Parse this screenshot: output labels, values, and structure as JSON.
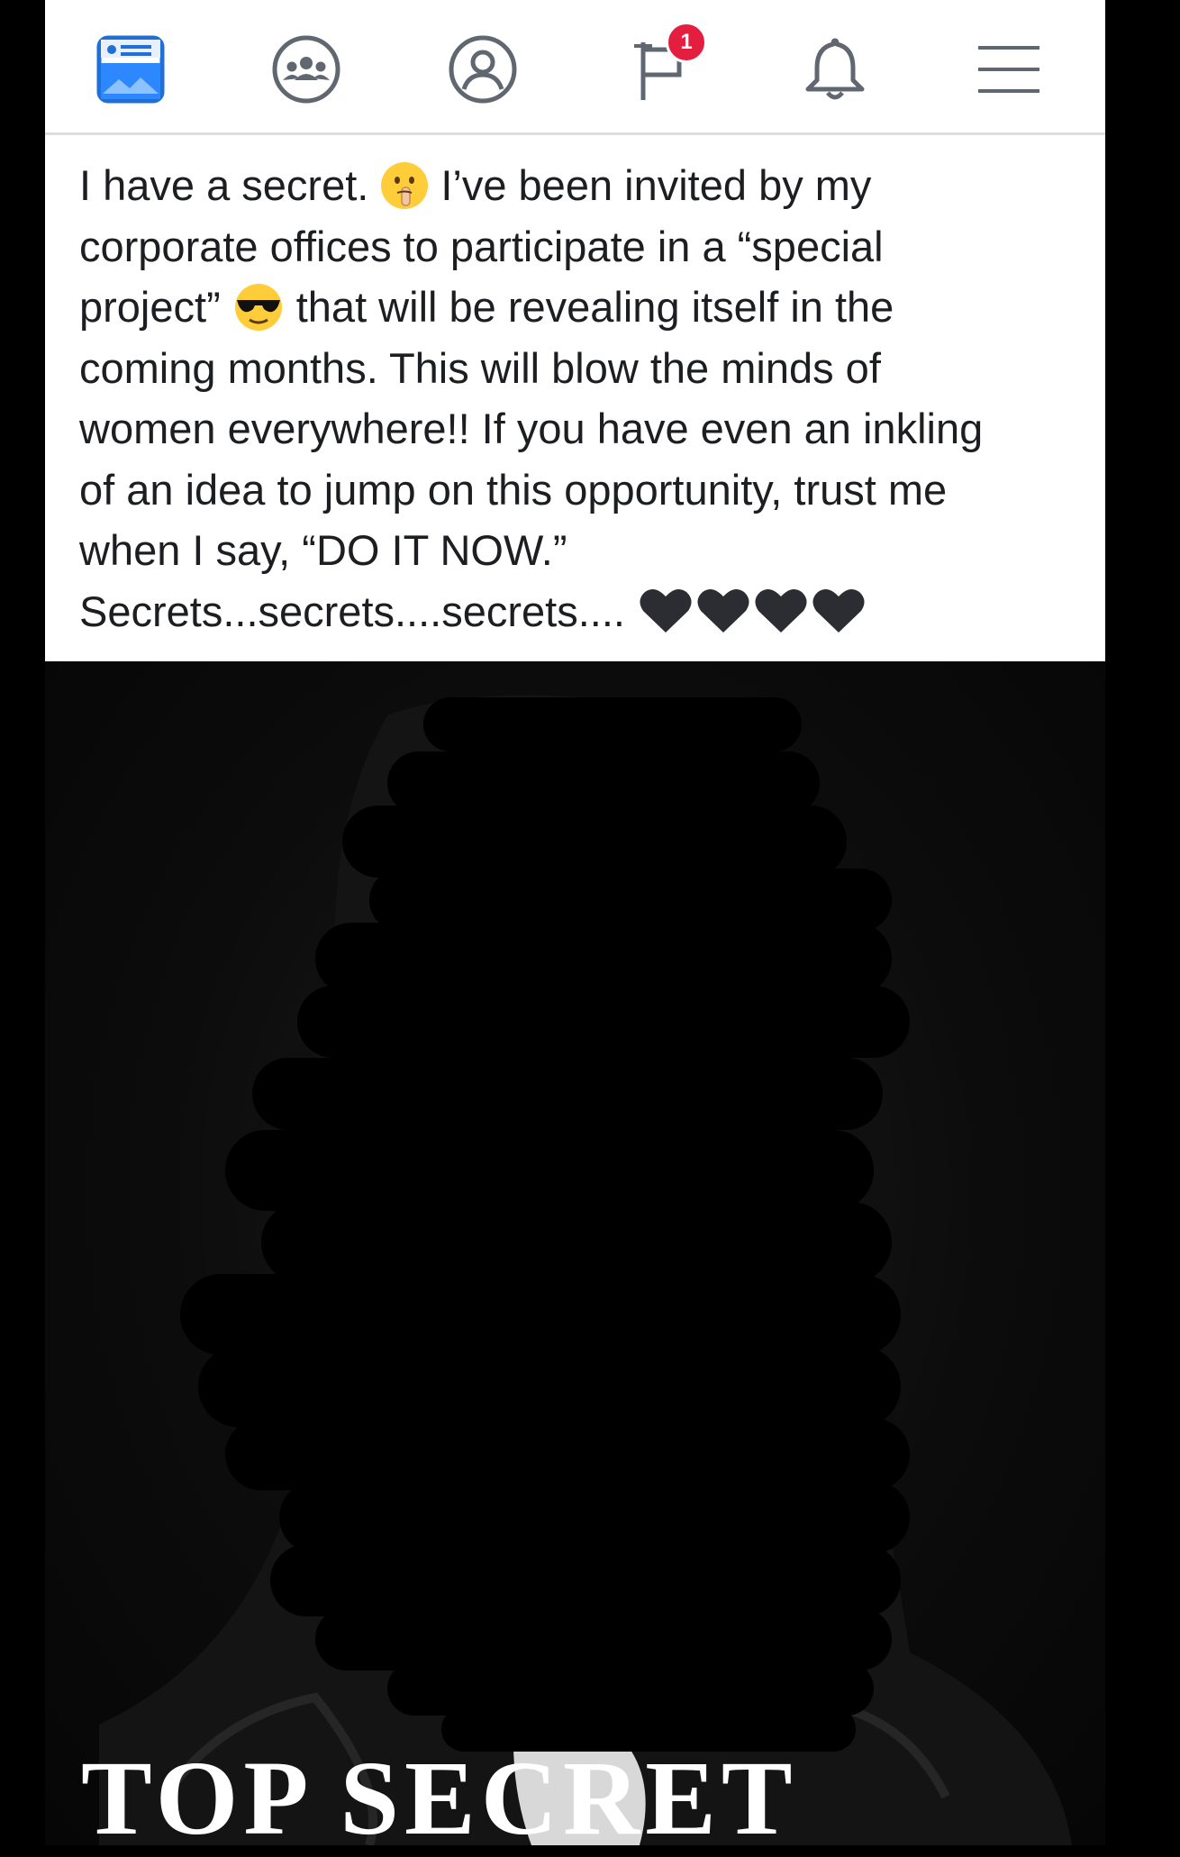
{
  "navbar": {
    "items": [
      {
        "name": "news-feed-icon",
        "label": ""
      },
      {
        "name": "groups-icon",
        "label": ""
      },
      {
        "name": "profile-icon",
        "label": ""
      },
      {
        "name": "pages-flag-icon",
        "label": ""
      },
      {
        "name": "notifications-bell-icon",
        "label": ""
      },
      {
        "name": "menu-icon",
        "label": ""
      }
    ],
    "pages_badge_count": "1",
    "accent_color": "#1877f2",
    "badge_color": "#e41e3f"
  },
  "post": {
    "lines": [
      {
        "before": "I have a secret.",
        "emoji": "shushing-face-emoji",
        "after": "I’ve been invited by my"
      },
      {
        "before": "corporate offices to participate in a “special",
        "emoji": "",
        "after": ""
      },
      {
        "before": "project”",
        "emoji": "sunglasses-face-emoji",
        "after": "that will be revealing itself in the"
      },
      {
        "before": "coming months. This will blow the minds of",
        "emoji": "",
        "after": ""
      },
      {
        "before": "women everywhere!! If you have even an inkling",
        "emoji": "",
        "after": ""
      },
      {
        "before": "of an idea to jump on this opportunity, trust me",
        "emoji": "",
        "after": ""
      },
      {
        "before": "when I say, “DO IT NOW.”",
        "emoji": "",
        "after": ""
      },
      {
        "before": "Secrets...secrets....secrets....",
        "emoji": "black-hearts-emoji",
        "after": ""
      }
    ],
    "hearts_count": 4
  },
  "image": {
    "caption": "TOP SECRET",
    "subject": "black-scribble-redaction"
  }
}
